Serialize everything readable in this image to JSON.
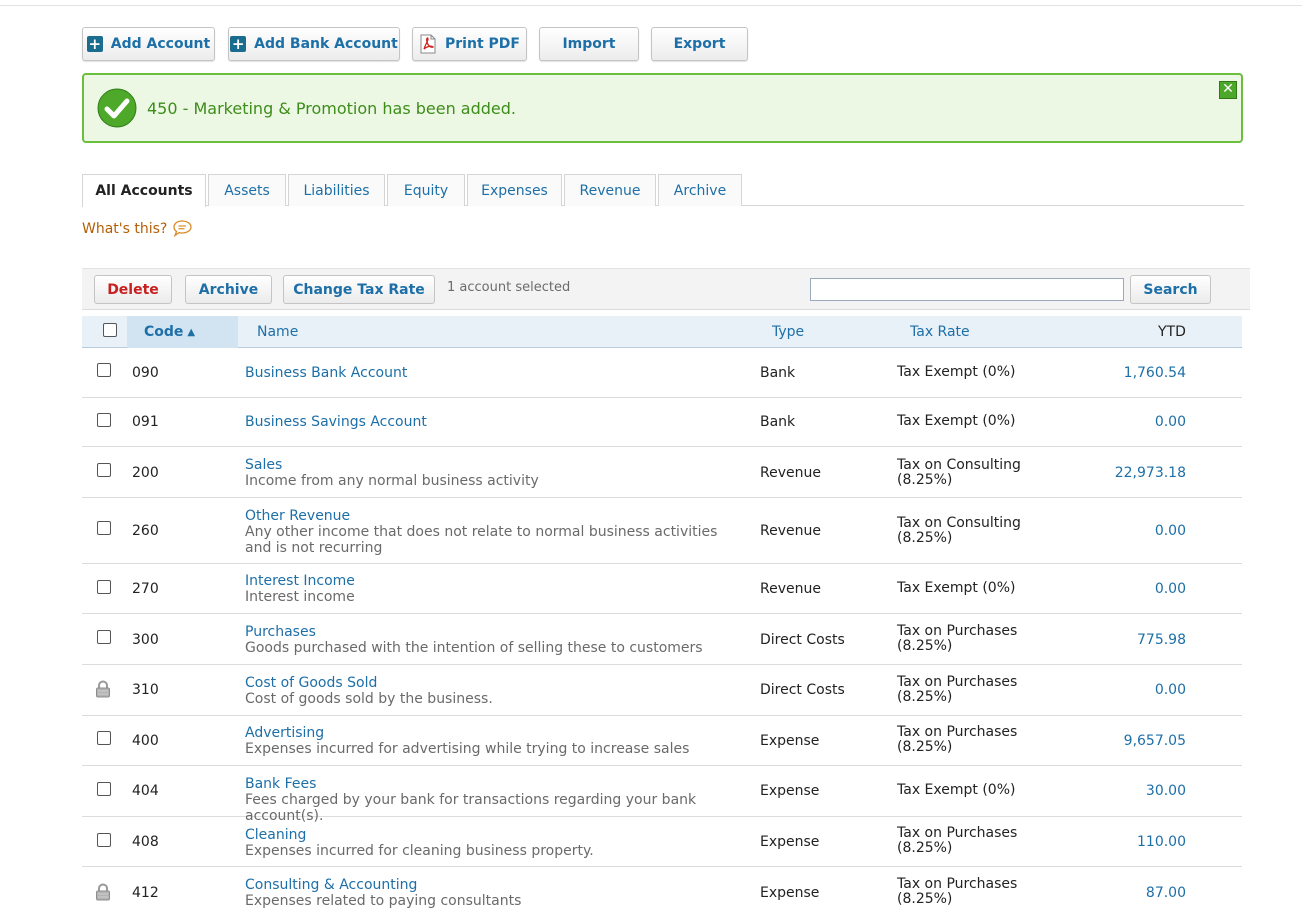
{
  "toolbar": {
    "add_account": "Add Account",
    "add_bank_account": "Add Bank Account",
    "print_pdf": "Print PDF",
    "import": "Import",
    "export": "Export"
  },
  "notification": {
    "message": "450 - Marketing & Promotion has been added.",
    "close": "✕"
  },
  "tabs": [
    {
      "label": "All Accounts",
      "active": true
    },
    {
      "label": "Assets"
    },
    {
      "label": "Liabilities"
    },
    {
      "label": "Equity"
    },
    {
      "label": "Expenses"
    },
    {
      "label": "Revenue"
    },
    {
      "label": "Archive"
    }
  ],
  "whats_this": "What's this?",
  "actions": {
    "delete": "Delete",
    "archive": "Archive",
    "change_tax_rate": "Change Tax Rate",
    "selected": "1 account selected",
    "search_button": "Search",
    "search_value": ""
  },
  "table": {
    "headers": {
      "code": "Code",
      "name": "Name",
      "type": "Type",
      "tax_rate": "Tax Rate",
      "ytd": "YTD"
    },
    "rows": [
      {
        "code": "090",
        "name": "Business Bank Account",
        "desc": "",
        "type": "Bank",
        "tax": "Tax Exempt (0%)",
        "ytd": "1,760.54",
        "locked": false
      },
      {
        "code": "091",
        "name": "Business Savings Account",
        "desc": "",
        "type": "Bank",
        "tax": "Tax Exempt (0%)",
        "ytd": "0.00",
        "locked": false
      },
      {
        "code": "200",
        "name": "Sales",
        "desc": "Income from any normal business activity",
        "type": "Revenue",
        "tax": "Tax on Consulting (8.25%)",
        "ytd": "22,973.18",
        "locked": false
      },
      {
        "code": "260",
        "name": "Other Revenue",
        "desc": "Any other income that does not relate to normal business activities and is not recurring",
        "type": "Revenue",
        "tax": "Tax on Consulting (8.25%)",
        "ytd": "0.00",
        "locked": false
      },
      {
        "code": "270",
        "name": "Interest Income",
        "desc": "Interest income",
        "type": "Revenue",
        "tax": "Tax Exempt (0%)",
        "ytd": "0.00",
        "locked": false
      },
      {
        "code": "300",
        "name": "Purchases",
        "desc": "Goods purchased with the intention of selling these to customers",
        "type": "Direct Costs",
        "tax": "Tax on Purchases (8.25%)",
        "ytd": "775.98",
        "locked": false
      },
      {
        "code": "310",
        "name": "Cost of Goods Sold",
        "desc": "Cost of goods sold by the business.",
        "type": "Direct Costs",
        "tax": "Tax on Purchases (8.25%)",
        "ytd": "0.00",
        "locked": true
      },
      {
        "code": "400",
        "name": "Advertising",
        "desc": "Expenses incurred for advertising while trying to increase sales",
        "type": "Expense",
        "tax": "Tax on Purchases (8.25%)",
        "ytd": "9,657.05",
        "locked": false
      },
      {
        "code": "404",
        "name": "Bank Fees",
        "desc": "Fees charged by your bank for transactions regarding your bank account(s).",
        "type": "Expense",
        "tax": "Tax Exempt (0%)",
        "ytd": "30.00",
        "locked": false
      },
      {
        "code": "408",
        "name": "Cleaning",
        "desc": "Expenses incurred for cleaning business property.",
        "type": "Expense",
        "tax": "Tax on Purchases (8.25%)",
        "ytd": "110.00",
        "locked": false
      },
      {
        "code": "412",
        "name": "Consulting & Accounting",
        "desc": "Expenses related to paying consultants",
        "type": "Expense",
        "tax": "Tax on Purchases (8.25%)",
        "ytd": "87.00",
        "locked": true
      }
    ]
  }
}
